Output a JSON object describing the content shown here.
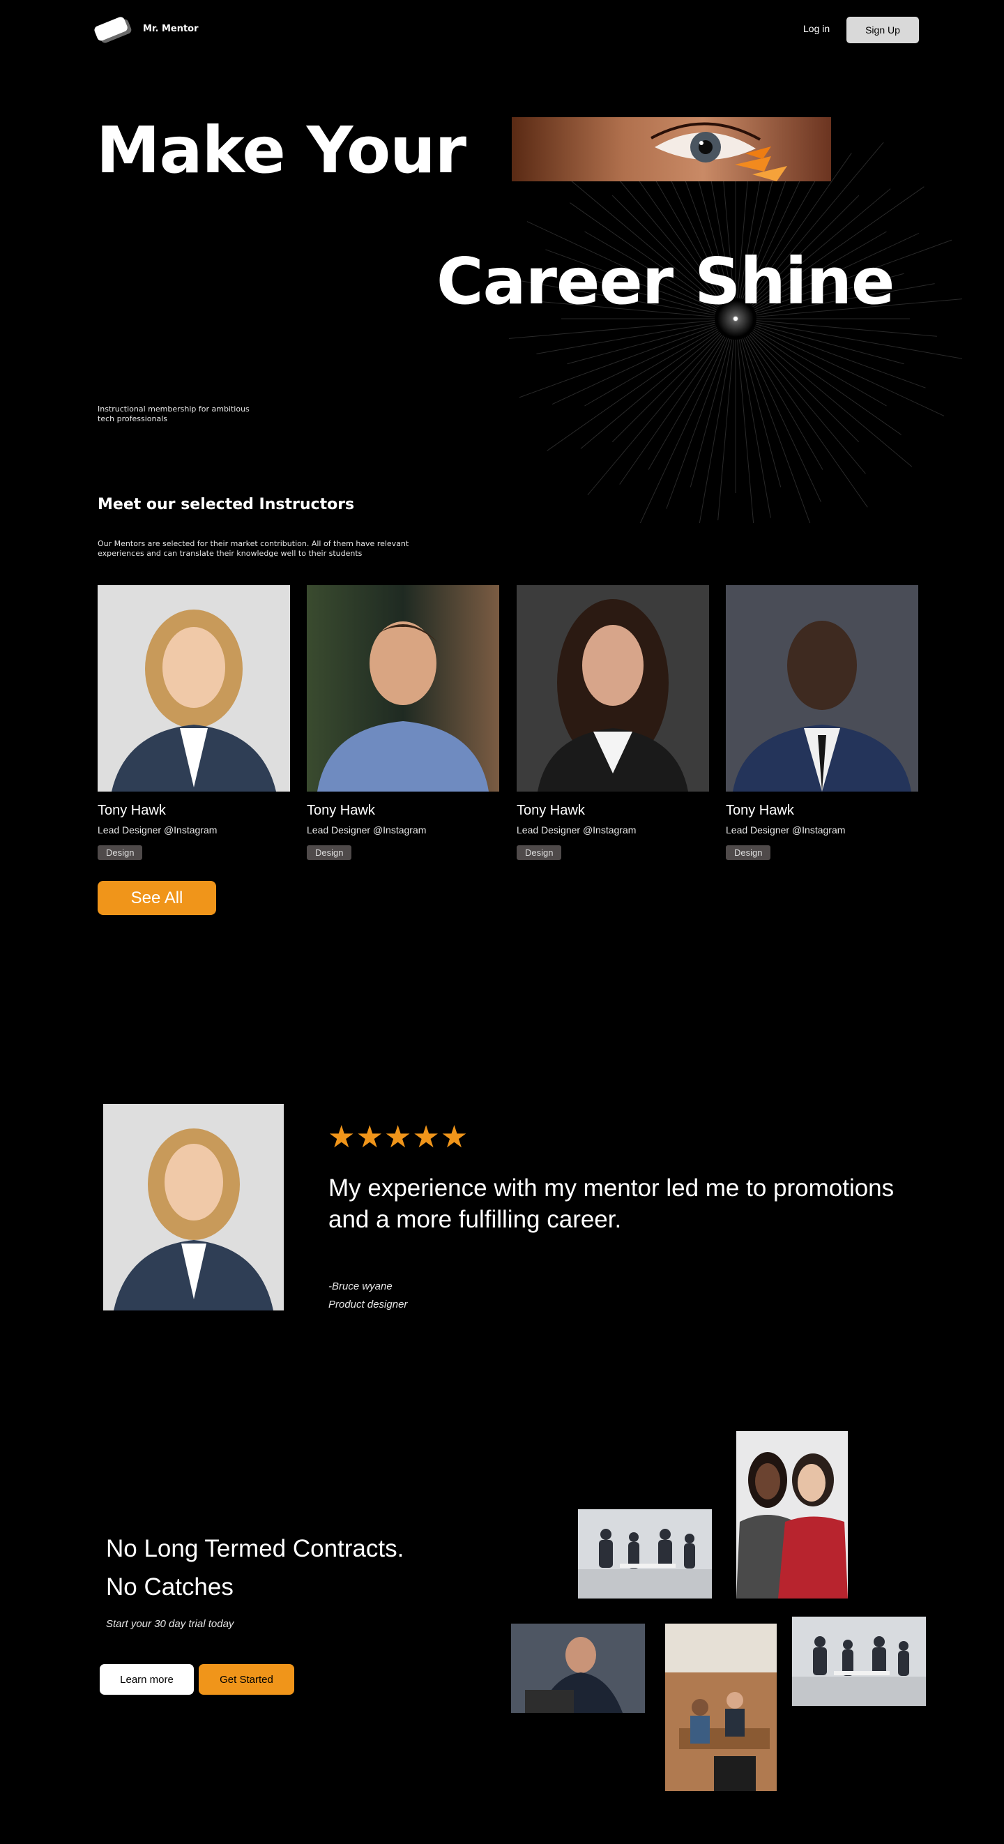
{
  "nav": {
    "brand": "Mr. Mentor",
    "login_label": "Log in",
    "signup_label": "Sign Up"
  },
  "hero": {
    "line1": "Make Your",
    "line2": "Career Shine",
    "subtitle": "Instructional membership for ambitious tech professionals"
  },
  "instructors": {
    "title": "Meet our selected Instructors",
    "description": "Our Mentors are selected for their market contribution. All of them have relevant experiences and can translate their knowledge well to their students",
    "cards": [
      {
        "name": "Tony Hawk",
        "role": "Lead Designer @Instagram",
        "tag": "Design"
      },
      {
        "name": "Tony Hawk",
        "role": "Lead Designer @Instagram",
        "tag": "Design"
      },
      {
        "name": "Tony Hawk",
        "role": "Lead Designer @Instagram",
        "tag": "Design"
      },
      {
        "name": "Tony Hawk",
        "role": "Lead Designer @Instagram",
        "tag": "Design"
      }
    ],
    "see_all_label": "See All"
  },
  "testimonial": {
    "rating": 5,
    "stars": "★★★★★",
    "quote": "My experience with my mentor led me to promotions and a more fulfilling career.",
    "author": "-Bruce wyane",
    "author_title": "Product designer"
  },
  "cta": {
    "line1": "No Long Termed Contracts.",
    "line2": "No Catches",
    "subtitle": "Start your 30 day trial today",
    "learn_more_label": "Learn more",
    "get_started_label": "Get Started"
  },
  "colors": {
    "background": "#000000",
    "accent": "#f0951a",
    "tag_bg": "#4f4a4a",
    "signup_bg": "#d9d9d9"
  }
}
